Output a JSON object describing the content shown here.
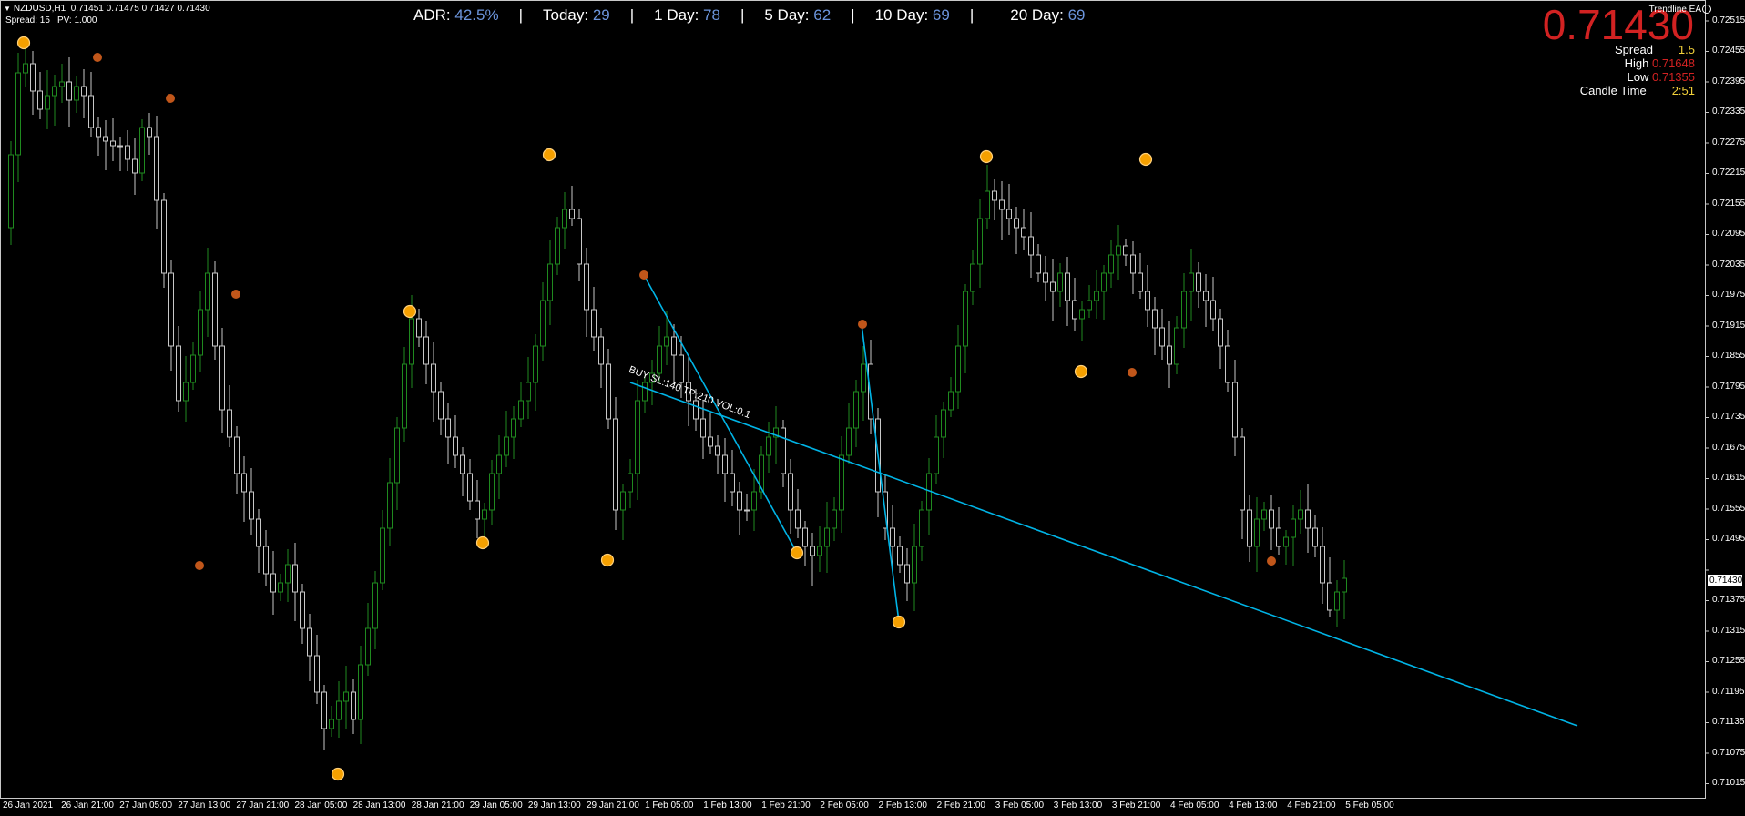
{
  "symbol_line": {
    "symbol": "NZDUSD,H1",
    "ohlc": "0.71451 0.71475 0.71427 0.71430"
  },
  "sub_line": {
    "spread": "Spread: 15",
    "pv": "PV: 1.000"
  },
  "adr_bar": {
    "adr_label": "ADR:",
    "adr_value": "42.5%",
    "today_label": "Today:",
    "today_value": "29",
    "day1_label": "1 Day:",
    "day1_value": "78",
    "day5_label": "5 Day:",
    "day5_value": "62",
    "day10_label": "10 Day:",
    "day10_value": "69",
    "day20_label": "20 Day:",
    "day20_value": "69",
    "separator": "|"
  },
  "ea_label": "Trendline EA",
  "big_price": "0.71430",
  "info_panel": {
    "spread_label": "Spread",
    "spread_value": "1.5",
    "high_label": "High",
    "high_value": "0.71648",
    "low_label": "Low",
    "low_value": "0.71355",
    "candle_label": "Candle Time",
    "candle_value": "2:51"
  },
  "current_price_tag": "0.71430",
  "trade_label": "BUY SL:140  TP:210  VOL:0.1",
  "price_axis": [
    "0.72515",
    "0.72455",
    "0.72395",
    "0.72335",
    "0.72275",
    "0.72215",
    "0.72155",
    "0.72095",
    "0.72035",
    "0.71975",
    "0.71915",
    "0.71855",
    "0.71795",
    "0.71735",
    "0.71675",
    "0.71615",
    "0.71555",
    "0.71495",
    "0.71430",
    "0.71375",
    "0.71315",
    "0.71255",
    "0.71195",
    "0.71135",
    "0.71075",
    "0.71015"
  ],
  "time_axis": [
    "26 Jan 2021",
    "26 Jan 21:00",
    "27 Jan 05:00",
    "27 Jan 13:00",
    "27 Jan 21:00",
    "28 Jan 05:00",
    "28 Jan 13:00",
    "28 Jan 21:00",
    "29 Jan 05:00",
    "29 Jan 13:00",
    "29 Jan 21:00",
    "1 Feb 05:00",
    "1 Feb 13:00",
    "1 Feb 21:00",
    "2 Feb 05:00",
    "2 Feb 13:00",
    "2 Feb 21:00",
    "3 Feb 05:00",
    "3 Feb 13:00",
    "3 Feb 21:00",
    "4 Feb 05:00",
    "4 Feb 13:00",
    "4 Feb 21:00",
    "5 Feb 05:00"
  ],
  "colors": {
    "background": "#000000",
    "bull_candle": "#1f8a1f",
    "bear_candle": "#c8c8c8",
    "trendline": "#00b4e6",
    "marker_major": "#f5a000",
    "marker_minor": "#c0561a",
    "big_price": "#d22222",
    "adr_value": "#6c95dc"
  }
}
